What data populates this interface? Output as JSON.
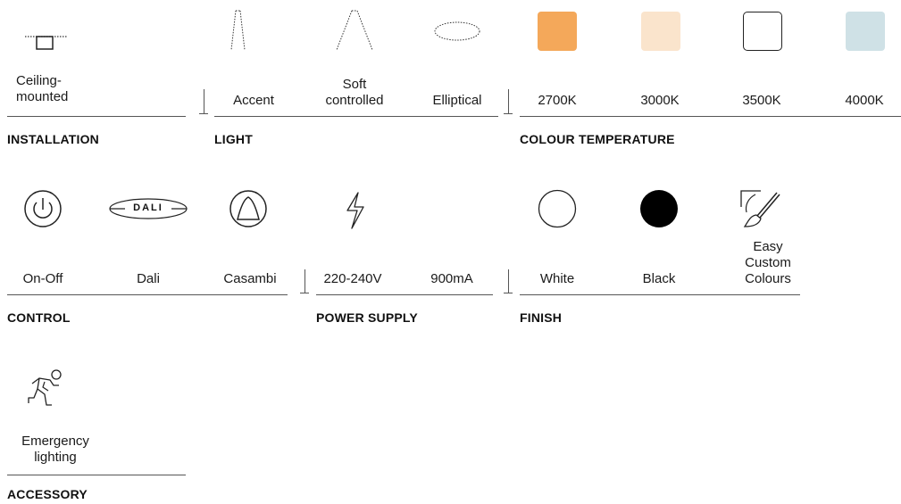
{
  "installation": {
    "heading": "INSTALLATION",
    "items": [
      {
        "label": "Ceiling-\nmounted",
        "icon": "ceiling-mounted-icon"
      }
    ]
  },
  "light": {
    "heading": "LIGHT",
    "items": [
      {
        "label": "Accent",
        "icon": "accent-beam-icon"
      },
      {
        "label": "Soft\ncontrolled",
        "icon": "soft-controlled-beam-icon"
      },
      {
        "label": "Elliptical",
        "icon": "elliptical-beam-icon"
      }
    ]
  },
  "colour_temperature": {
    "heading": "COLOUR TEMPERATURE",
    "items": [
      {
        "label": "2700K",
        "color": "#F4A85A"
      },
      {
        "label": "3000K",
        "color": "#FAE4CC"
      },
      {
        "label": "3500K",
        "color": "#FFFFFF"
      },
      {
        "label": "4000K",
        "color": "#CFE1E6"
      }
    ]
  },
  "control": {
    "heading": "CONTROL",
    "items": [
      {
        "label": "On-Off",
        "icon": "power-icon"
      },
      {
        "label": "Dali",
        "icon": "dali-logo-icon",
        "logo_text": "DALI"
      },
      {
        "label": "Casambi",
        "icon": "casambi-icon"
      }
    ]
  },
  "power_supply": {
    "heading": "POWER SUPPLY",
    "items": [
      {
        "label": "220-240V",
        "icon": "lightning-icon"
      },
      {
        "label": "900mA"
      }
    ]
  },
  "finish": {
    "heading": "FINISH",
    "items": [
      {
        "label": "White",
        "color": "#FFFFFF"
      },
      {
        "label": "Black",
        "color": "#000000"
      },
      {
        "label": "Easy\nCustom\nColours",
        "icon": "paintbrush-icon"
      }
    ]
  },
  "accessory": {
    "heading": "ACCESSORY",
    "items": [
      {
        "label": "Emergency\nlighting",
        "icon": "emergency-exit-icon"
      }
    ]
  }
}
